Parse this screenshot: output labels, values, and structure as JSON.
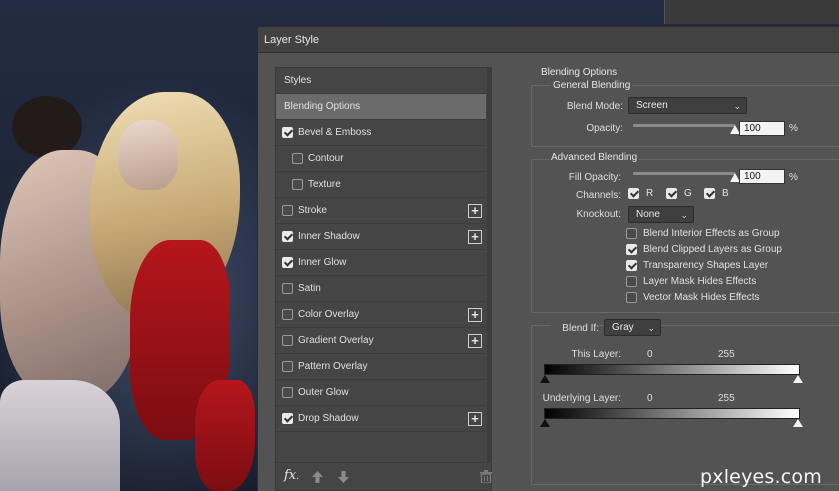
{
  "dialog": {
    "title": "Layer Style"
  },
  "styles_panel": {
    "header": "Styles",
    "items": [
      {
        "label": "Blending Options",
        "checked": null,
        "has_plus": false,
        "indent": false,
        "active": true
      },
      {
        "label": "Bevel & Emboss",
        "checked": true,
        "has_plus": false,
        "indent": false,
        "active": false
      },
      {
        "label": "Contour",
        "checked": false,
        "has_plus": false,
        "indent": true,
        "active": false
      },
      {
        "label": "Texture",
        "checked": false,
        "has_plus": false,
        "indent": true,
        "active": false
      },
      {
        "label": "Stroke",
        "checked": false,
        "has_plus": true,
        "indent": false,
        "active": false
      },
      {
        "label": "Inner Shadow",
        "checked": true,
        "has_plus": true,
        "indent": false,
        "active": false
      },
      {
        "label": "Inner Glow",
        "checked": true,
        "has_plus": false,
        "indent": false,
        "active": false
      },
      {
        "label": "Satin",
        "checked": false,
        "has_plus": false,
        "indent": false,
        "active": false
      },
      {
        "label": "Color Overlay",
        "checked": false,
        "has_plus": true,
        "indent": false,
        "active": false
      },
      {
        "label": "Gradient Overlay",
        "checked": false,
        "has_plus": true,
        "indent": false,
        "active": false
      },
      {
        "label": "Pattern Overlay",
        "checked": false,
        "has_plus": false,
        "indent": false,
        "active": false
      },
      {
        "label": "Outer Glow",
        "checked": false,
        "has_plus": false,
        "indent": false,
        "active": false
      },
      {
        "label": "Drop Shadow",
        "checked": true,
        "has_plus": true,
        "indent": false,
        "active": false
      }
    ],
    "footer": {
      "fx_label": "fx",
      "fx_suffix": "."
    }
  },
  "options": {
    "title": "Blending Options",
    "general": {
      "title": "General Blending",
      "blend_mode_label": "Blend Mode:",
      "blend_mode_value": "Screen",
      "opacity_label": "Opacity:",
      "opacity_value": "100",
      "opacity_unit": "%",
      "opacity_level": 1.0
    },
    "advanced": {
      "title": "Advanced Blending",
      "fill_opacity_label": "Fill Opacity:",
      "fill_opacity_value": "100",
      "fill_opacity_unit": "%",
      "fill_opacity_level": 1.0,
      "channels_label": "Channels:",
      "channels": [
        {
          "label": "R",
          "checked": true
        },
        {
          "label": "G",
          "checked": true
        },
        {
          "label": "B",
          "checked": true
        }
      ],
      "knockout_label": "Knockout:",
      "knockout_value": "None",
      "checkboxes": [
        {
          "label": "Blend Interior Effects as Group",
          "checked": false
        },
        {
          "label": "Blend Clipped Layers as Group",
          "checked": true
        },
        {
          "label": "Transparency Shapes Layer",
          "checked": true
        },
        {
          "label": "Layer Mask Hides Effects",
          "checked": false
        },
        {
          "label": "Vector Mask Hides Effects",
          "checked": false
        }
      ]
    },
    "blend_if": {
      "label": "Blend If:",
      "value": "Gray",
      "this_layer_label": "This Layer:",
      "this_layer_low": "0",
      "this_layer_high": "255",
      "underlying_label": "Underlying Layer:",
      "underlying_low": "0",
      "underlying_high": "255"
    }
  },
  "watermark": "pxleyes.com",
  "colors": {
    "dialog_bg": "#535353",
    "active_row": "#6b6b6b",
    "list_bg": "#454545"
  },
  "icons": {
    "checkbox": "check-icon",
    "plus": "plus-icon",
    "caret": "chevron-down-icon",
    "up": "arrow-up-icon",
    "down": "arrow-down-icon",
    "trash": "trash-icon"
  }
}
